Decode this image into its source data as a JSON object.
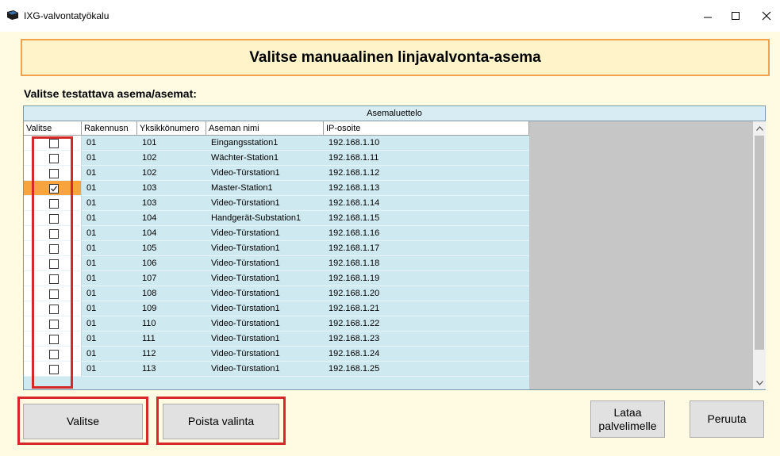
{
  "window": {
    "title": "IXG-valvontatyökalu"
  },
  "header": {
    "title": "Valitse manuaalinen linjavalvonta-asema"
  },
  "section_label": "Valitse testattava asema/asemat:",
  "station_list": {
    "caption": "Asemaluettelo",
    "columns": [
      "Valitse",
      "Rakennusn",
      "Yksikkönumero",
      "Aseman nimi",
      "IP-osoite"
    ],
    "rows": [
      {
        "checked": false,
        "building": "01",
        "unit": "101",
        "name": "Eingangsstation1",
        "ip": "192.168.1.10"
      },
      {
        "checked": false,
        "building": "01",
        "unit": "102",
        "name": "Wächter-Station1",
        "ip": "192.168.1.11"
      },
      {
        "checked": false,
        "building": "01",
        "unit": "102",
        "name": "Video-Türstation1",
        "ip": "192.168.1.12"
      },
      {
        "checked": true,
        "building": "01",
        "unit": "103",
        "name": "Master-Station1",
        "ip": "192.168.1.13"
      },
      {
        "checked": false,
        "building": "01",
        "unit": "103",
        "name": "Video-Türstation1",
        "ip": "192.168.1.14"
      },
      {
        "checked": false,
        "building": "01",
        "unit": "104",
        "name": "Handgerät-Substation1",
        "ip": "192.168.1.15"
      },
      {
        "checked": false,
        "building": "01",
        "unit": "104",
        "name": "Video-Türstation1",
        "ip": "192.168.1.16"
      },
      {
        "checked": false,
        "building": "01",
        "unit": "105",
        "name": "Video-Türstation1",
        "ip": "192.168.1.17"
      },
      {
        "checked": false,
        "building": "01",
        "unit": "106",
        "name": "Video-Türstation1",
        "ip": "192.168.1.18"
      },
      {
        "checked": false,
        "building": "01",
        "unit": "107",
        "name": "Video-Türstation1",
        "ip": "192.168.1.19"
      },
      {
        "checked": false,
        "building": "01",
        "unit": "108",
        "name": "Video-Türstation1",
        "ip": "192.168.1.20"
      },
      {
        "checked": false,
        "building": "01",
        "unit": "109",
        "name": "Video-Türstation1",
        "ip": "192.168.1.21"
      },
      {
        "checked": false,
        "building": "01",
        "unit": "110",
        "name": "Video-Türstation1",
        "ip": "192.168.1.22"
      },
      {
        "checked": false,
        "building": "01",
        "unit": "111",
        "name": "Video-Türstation1",
        "ip": "192.168.1.23"
      },
      {
        "checked": false,
        "building": "01",
        "unit": "112",
        "name": "Video-Türstation1",
        "ip": "192.168.1.24"
      },
      {
        "checked": false,
        "building": "01",
        "unit": "113",
        "name": "Video-Türstation1",
        "ip": "192.168.1.25"
      }
    ]
  },
  "buttons": {
    "select": "Valitse",
    "deselect": "Poista valinta",
    "upload_line1": "Lataa",
    "upload_line2": "palvelimelle",
    "cancel": "Peruuta"
  },
  "colors": {
    "selected_row_accent": "#f7a33e",
    "highlight_box": "#d62828",
    "header_border": "#f0a14a"
  },
  "icons": [
    "app-icon",
    "minimize-icon",
    "maximize-icon",
    "close-icon",
    "checkbox-icon",
    "scroll-up-icon",
    "scroll-down-icon"
  ]
}
